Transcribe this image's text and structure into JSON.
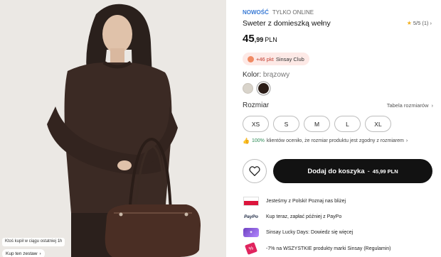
{
  "photo": {
    "toast_text": "Ktoś kupił w ciągu ostatniej 1h",
    "look_button_label": "Kup ten zestaw",
    "look_button_icon": "chevron-right-icon"
  },
  "product": {
    "badge_new": "NOWOŚĆ",
    "badge_online": "TYLKO ONLINE",
    "title": "Sweter z domieszką wełny",
    "price_int": "45",
    "price_dec": ",99",
    "price_currency": "PLN",
    "rating_value": "5/5",
    "rating_count": "(1)",
    "rating_icon": "star-icon",
    "club_points": "+46 pkt",
    "club_name": "Sinsay Club",
    "color_label": "Kolor:",
    "color_value": "brązowy",
    "colors": [
      "#d9d4cb",
      "#2b1d17"
    ],
    "size_label": "Rozmiar",
    "size_guide_label": "Tabela rozmiarów",
    "sizes": [
      "XS",
      "S",
      "M",
      "L",
      "XL"
    ],
    "fit_percent": "100%",
    "fit_text": "klientów oceniło, że rozmiar produktu jest zgodny z rozmiarem",
    "add_to_cart_label": "Dodaj do koszyka",
    "add_to_cart_price": "45,99 PLN",
    "accent_color": "#121212"
  },
  "info_rows": [
    {
      "icon": "poland-flag-icon",
      "text": "Jesteśmy z Polski! Poznaj nas bliżej"
    },
    {
      "icon": "paypo-icon",
      "badge": "PayPo",
      "text": "Kup teraz, zapłać później z PayPo"
    },
    {
      "icon": "lucky-days-icon",
      "text": "Sinsay Lucky Days: Dowiedz się więcej"
    },
    {
      "icon": "promo-tag-icon",
      "text": "-7% na WSZYSTKIE produkty marki Sinsay (Regulamin)"
    }
  ]
}
